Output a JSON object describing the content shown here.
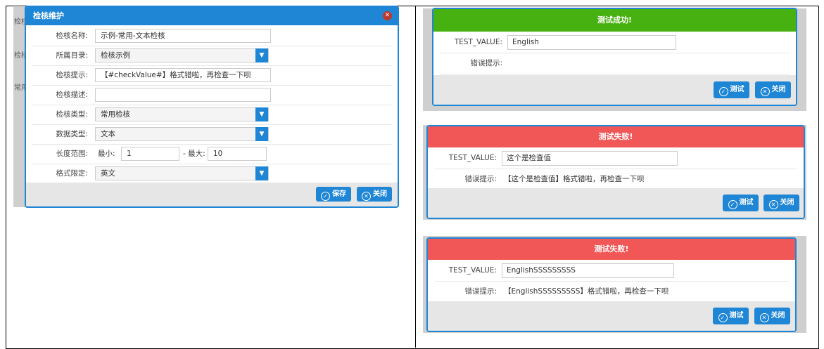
{
  "colors": {
    "accent": "#1f86d6",
    "success": "#48b112",
    "failure": "#f25757",
    "close_icon": "#c0392b"
  },
  "left_dialog": {
    "title": "检核维护",
    "bg_labels": [
      "检核",
      "检核",
      "常用"
    ],
    "fields": [
      {
        "label": "检核名称:",
        "value": "示例-常用-文本检核",
        "type": "input"
      },
      {
        "label": "所属目录:",
        "value": "检核示例",
        "type": "select"
      },
      {
        "label": "检核提示:",
        "value": "【#checkValue#】格式错啦，再检查一下呗",
        "type": "input"
      },
      {
        "label": "检核描述:",
        "value": "",
        "type": "input"
      },
      {
        "label": "检核类型:",
        "value": "常用检核",
        "type": "select"
      },
      {
        "label": "数据类型:",
        "value": "文本",
        "type": "select"
      }
    ],
    "range": {
      "label": "长度范围:",
      "min_label": "最小:",
      "min_value": "1",
      "max_label": "- 最大:",
      "max_value": "10"
    },
    "format": {
      "label": "格式限定:",
      "value": "英文"
    },
    "buttons": {
      "save": "保存",
      "close": "关闭"
    }
  },
  "test_dialogs": [
    {
      "status": "测试成功!",
      "color": "#48b112",
      "field_label": "TEST_VALUE:",
      "value": "English",
      "error_label": "错误提示:",
      "error_text": "",
      "test_button": "测试",
      "close_button": "关闭"
    },
    {
      "status": "测试失败!",
      "color": "#f25757",
      "field_label": "TEST_VALUE:",
      "value": "这个是检查值",
      "error_label": "错误提示:",
      "error_text": "【这个是检查值】格式错啦，再检查一下呗",
      "test_button": "测试",
      "close_button": "关闭"
    },
    {
      "status": "测试失败!",
      "color": "#f25757",
      "field_label": "TEST_VALUE:",
      "value": "EnglishSSSSSSSSS",
      "error_label": "错误提示:",
      "error_text": "【EnglishSSSSSSSSS】格式错啦，再检查一下呗",
      "test_button": "测试",
      "close_button": "关闭"
    }
  ]
}
